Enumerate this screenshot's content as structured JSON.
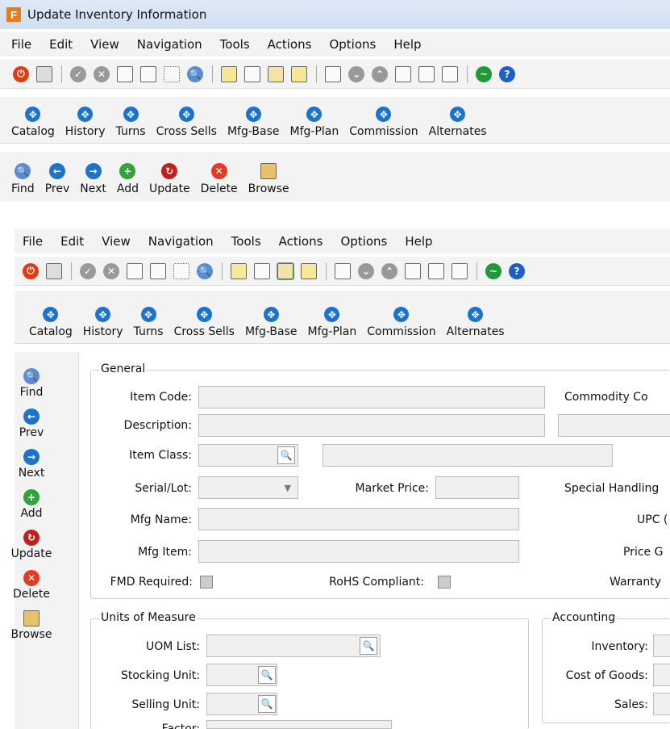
{
  "window": {
    "title": "Update Inventory Information",
    "app_icon": "F"
  },
  "menu": [
    "File",
    "Edit",
    "View",
    "Navigation",
    "Tools",
    "Actions",
    "Options",
    "Help"
  ],
  "nav": [
    "Catalog",
    "History",
    "Turns",
    "Cross Sells",
    "Mfg-Base",
    "Mfg-Plan",
    "Commission",
    "Alternates"
  ],
  "actions": [
    "Find",
    "Prev",
    "Next",
    "Add",
    "Update",
    "Delete",
    "Browse"
  ],
  "general": {
    "legend": "General",
    "item_code": "Item Code:",
    "commodity": "Commodity Co",
    "description": "Description:",
    "item_class": "Item Class:",
    "serial_lot": "Serial/Lot:",
    "market_price": "Market Price:",
    "special_handling": "Special Handling",
    "mfg_name": "Mfg Name:",
    "upc": "UPC (",
    "mfg_item": "Mfg Item:",
    "price_g": "Price G",
    "fmd": "FMD Required:",
    "rohs": "RoHS Compliant:",
    "warranty": "Warranty"
  },
  "uom": {
    "legend": "Units of Measure",
    "uom_list": "UOM List:",
    "stocking": "Stocking Unit:",
    "selling": "Selling Unit:",
    "factor": "Factor:"
  },
  "accounting": {
    "legend": "Accounting",
    "inventory": "Inventory:",
    "cogs": "Cost of Goods:",
    "sales": "Sales:"
  }
}
